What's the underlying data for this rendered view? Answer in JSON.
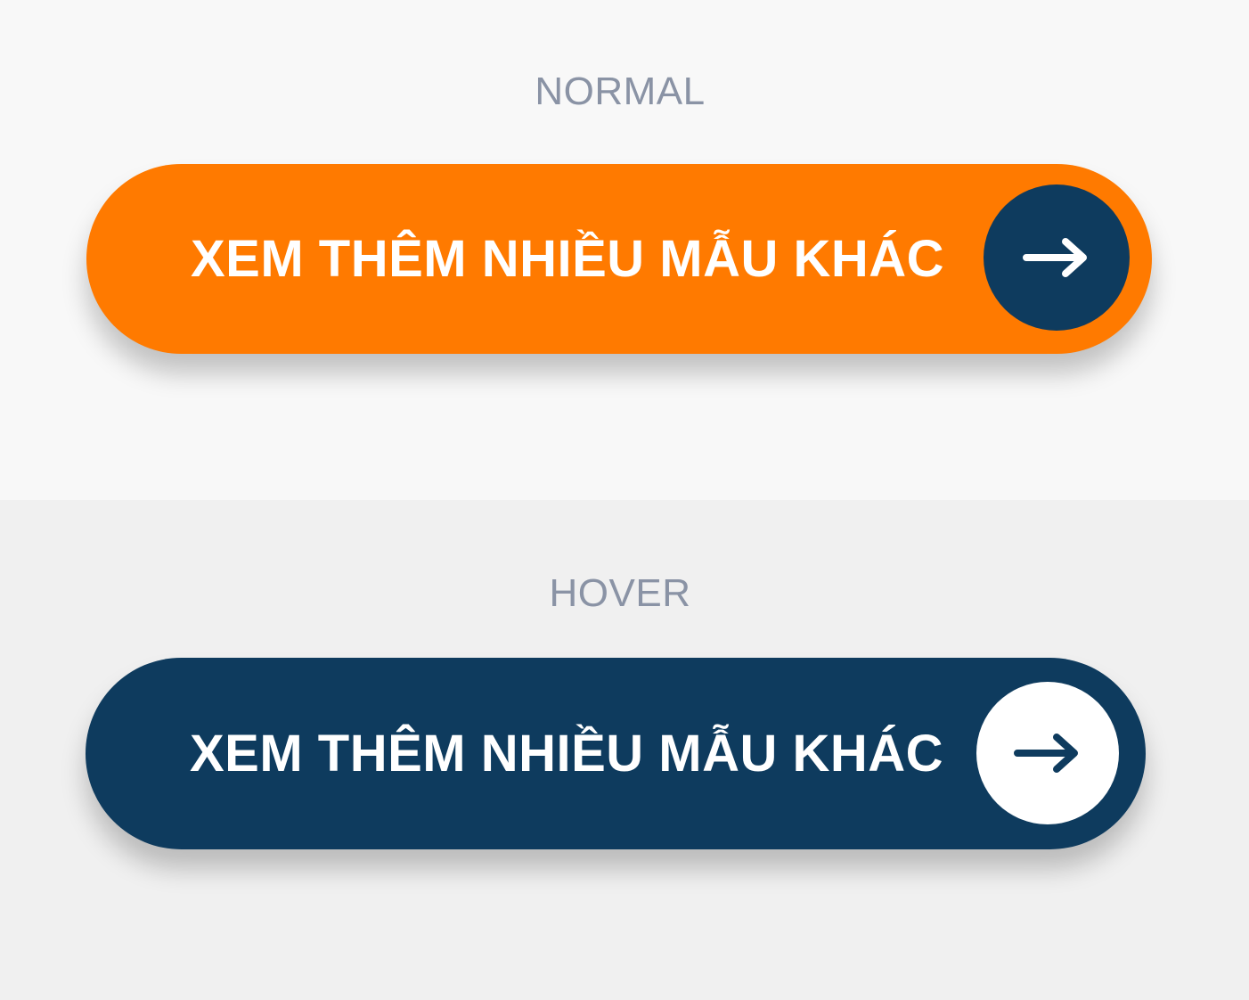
{
  "states": {
    "normal": {
      "label": "NORMAL",
      "button_text": "XEM THÊM NHIỀU MẪU KHÁC",
      "button_bg": "#ff7a00",
      "circle_bg": "#0e3b5e",
      "arrow_color": "#ffffff",
      "icon": "arrow-right-icon"
    },
    "hover": {
      "label": "HOVER",
      "button_text": "XEM THÊM NHIỀU MẪU KHÁC",
      "button_bg": "#0e3b5e",
      "circle_bg": "#ffffff",
      "arrow_color": "#0e3b5e",
      "icon": "arrow-right-icon"
    }
  },
  "colors": {
    "label_text": "#8a93a5",
    "panel_normal_bg": "#f8f8f8",
    "panel_hover_bg": "#f0f0f0"
  }
}
